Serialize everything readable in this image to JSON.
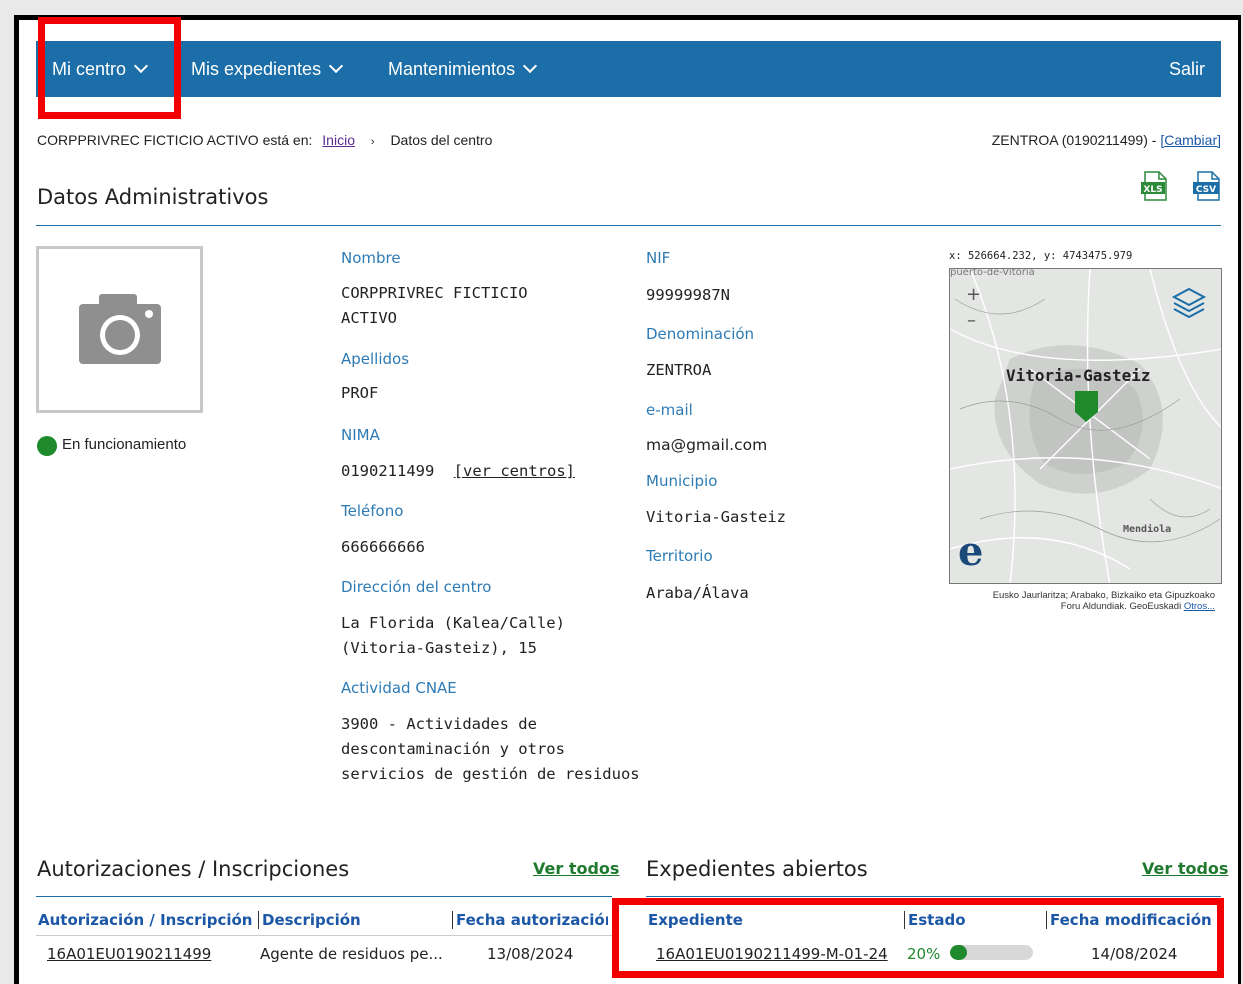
{
  "nav": {
    "items": [
      {
        "label": "Mi centro"
      },
      {
        "label": "Mis expedientes"
      },
      {
        "label": "Mantenimientos"
      }
    ],
    "salir": "Salir"
  },
  "breadcrumb": {
    "prefix": "CORPPRIVREC FICTICIO ACTIVO está en:",
    "inicio": "Inicio",
    "sep": "›",
    "current": "Datos del centro"
  },
  "centre": {
    "label": "ZENTROA (0190211499) -",
    "cambiar": "[Cambiar]"
  },
  "export": {
    "xls": "XLS",
    "csv": "CSV"
  },
  "section_title": "Datos Administrativos",
  "status": {
    "text": "En funcionamiento",
    "color": "#1e8a2c"
  },
  "fields": {
    "nombre_label": "Nombre",
    "nombre_l1": "CORPPRIVREC FICTICIO",
    "nombre_l2": "ACTIVO",
    "apellidos_label": "Apellidos",
    "apellidos": "PROF",
    "nima_label": "NIMA",
    "nima": "0190211499",
    "ver_centros": "[ver centros]",
    "telefono_label": "Teléfono",
    "telefono": "666666666",
    "direccion_label": "Dirección del centro",
    "direccion_l1": "La Florida (Kalea/Calle)",
    "direccion_l2": "(Vitoria-Gasteiz), 15",
    "cnae_label": "Actividad CNAE",
    "cnae_l1": "3900 - Actividades de",
    "cnae_l2": "descontaminación y otros",
    "cnae_l3": "servicios de gestión de residuos",
    "nif_label": "NIF",
    "nif": "99999987N",
    "denominacion_label": "Denominación",
    "denominacion": "ZENTROA",
    "email_label": "e-mail",
    "email": "ma@gmail.com",
    "municipio_label": "Municipio",
    "municipio": "Vitoria-Gasteiz",
    "territorio_label": "Territorio",
    "territorio": "Araba/Álava"
  },
  "map": {
    "coords": "x: 526664.232, y: 4743475.979",
    "top_partial": "puerto-de-Vitoria",
    "city": "Vitoria-Gasteiz",
    "place": "Mendiola",
    "zoom_in": "+",
    "zoom_out": "–",
    "logo": "e",
    "attrib_l1": "Eusko Jaurlaritza; Arabako, Bizkaiko eta Gipuzkoako",
    "attrib_l2": "Foru Aldundiak. GeoEuskadi",
    "attrib_link": "Otros..."
  },
  "autorizaciones": {
    "title": "Autorizaciones / Inscripciones",
    "ver_todos": "Ver todos",
    "headers": [
      "Autorización / Inscripción",
      "Descripción",
      "Fecha autorización"
    ],
    "rows": [
      {
        "code": "16A01EU0190211499",
        "desc": "Agente de residuos pe...",
        "date": "13/08/2024"
      }
    ]
  },
  "expedientes": {
    "title": "Expedientes abiertos",
    "ver_todos": "Ver todos",
    "headers": [
      "Expediente",
      "Estado",
      "Fecha modificación"
    ],
    "rows": [
      {
        "code": "16A01EU0190211499-M-01-24",
        "pct": "20%",
        "progress": 0.2,
        "date": "14/08/2024"
      }
    ]
  }
}
